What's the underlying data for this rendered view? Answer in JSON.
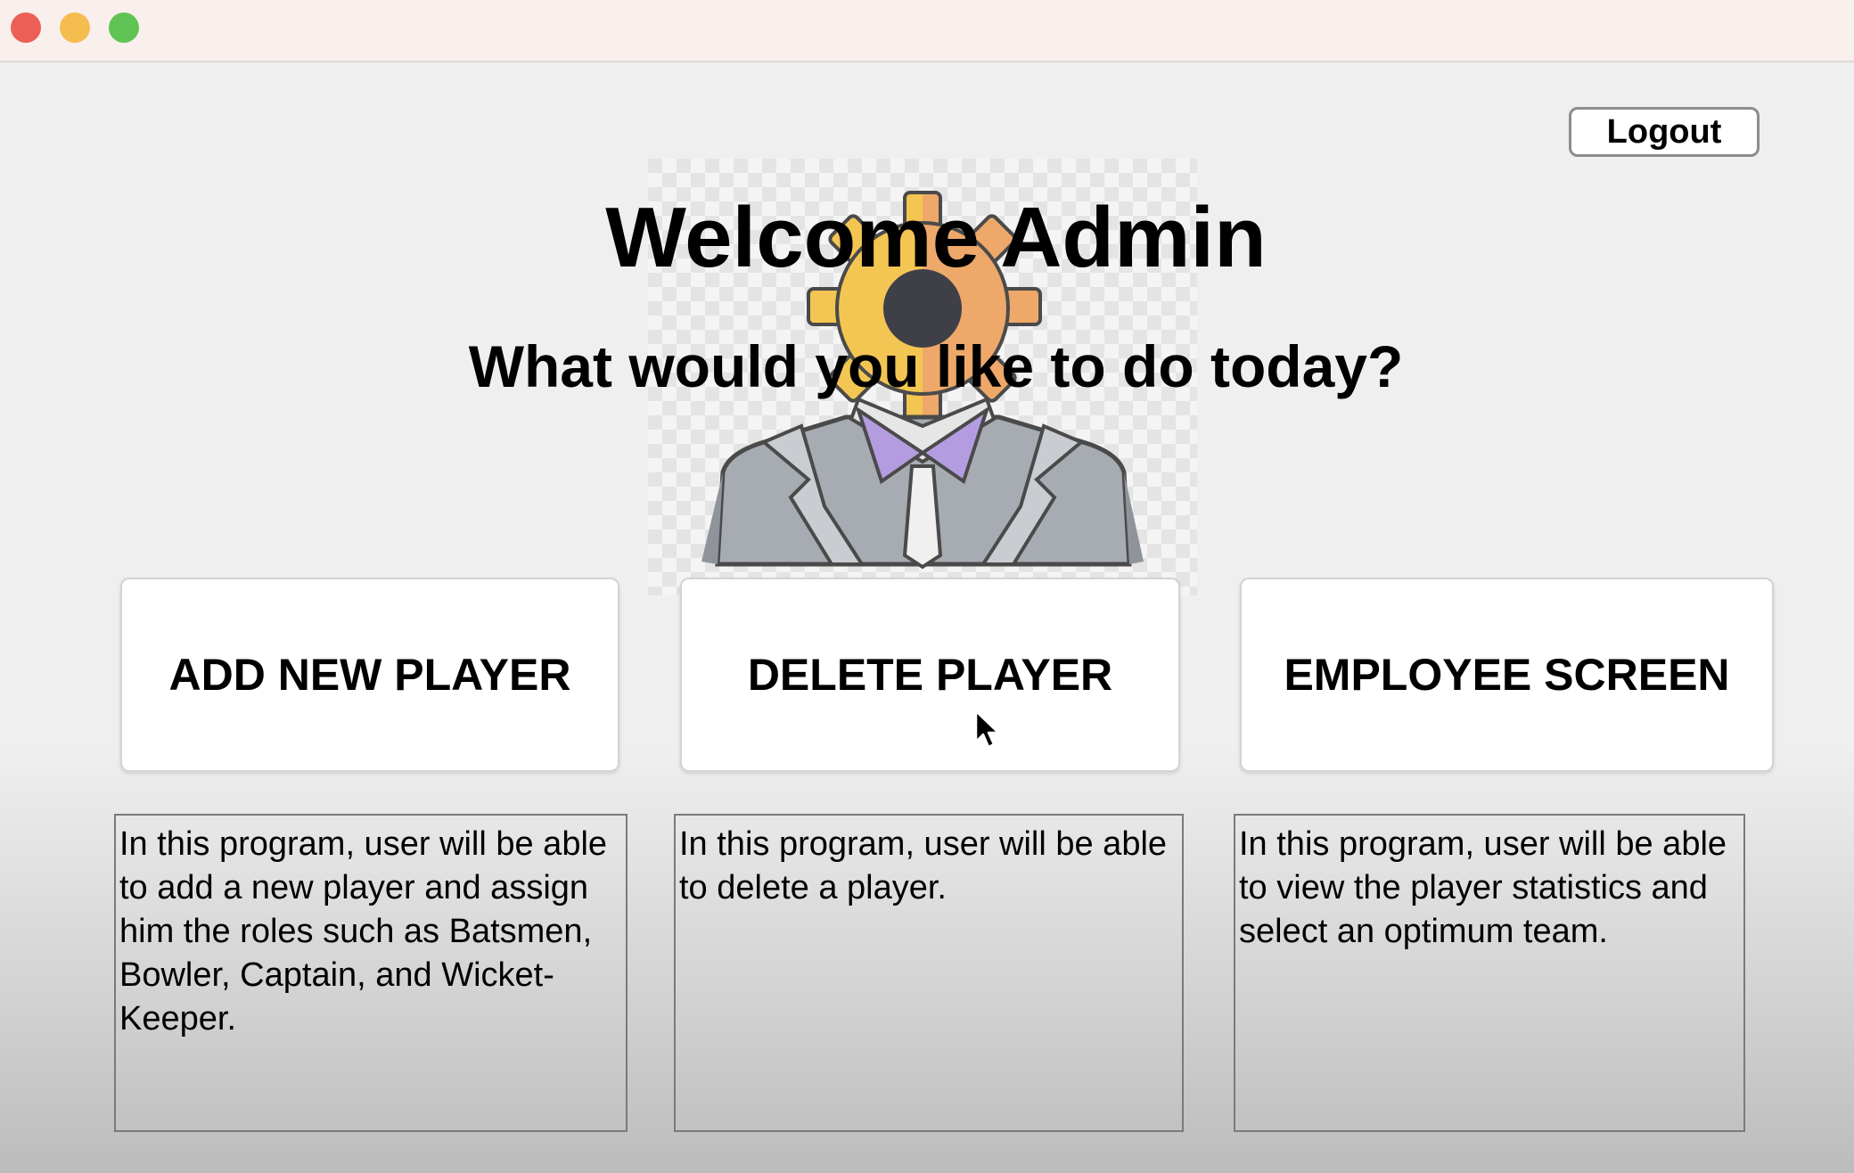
{
  "window": {
    "traffic_lights": [
      {
        "name": "close",
        "color": "#ec5f57"
      },
      {
        "name": "minimize",
        "color": "#f5bd4f"
      },
      {
        "name": "zoom",
        "color": "#5fc454"
      }
    ]
  },
  "header": {
    "logout_label": "Logout",
    "welcome": "Welcome Admin",
    "question": "What would you like to do today?"
  },
  "illustration": {
    "icon": "admin-gear-head-icon",
    "colors": {
      "gear_yellow": "#f3c552",
      "gear_orange": "#eea86a",
      "hub": "#3f3f48",
      "suit": "#a7acb3",
      "collar": "#b39ce0",
      "shirt": "#e6e6e6"
    }
  },
  "actions": [
    {
      "label": "ADD NEW PLAYER",
      "description": "In this program, user will be able to add a new player and assign him the roles such as Batsmen, Bowler, Captain, and Wicket-Keeper."
    },
    {
      "label": "DELETE PLAYER",
      "description": "In this program, user will be able to delete a player."
    },
    {
      "label": "EMPLOYEE SCREEN",
      "description": "In this program, user will be able to view the player statistics and select an optimum team."
    }
  ]
}
